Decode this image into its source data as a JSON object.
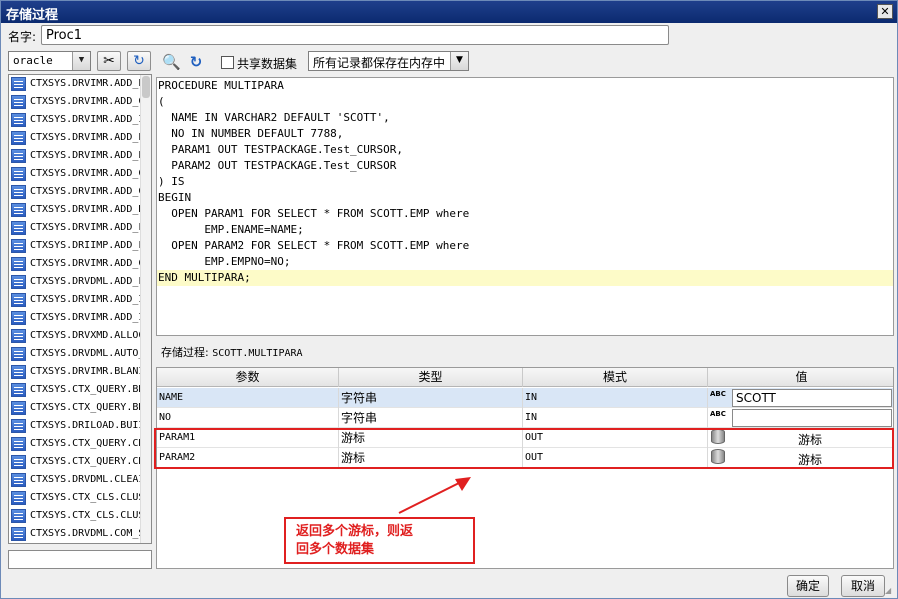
{
  "window": {
    "title": "存储过程",
    "close_glyph": "✕"
  },
  "name_field": {
    "label": "名字:",
    "value": "Proc1"
  },
  "toolbar": {
    "schema_combo": "oracle",
    "share_dataset_label": "共享数据集",
    "mode_combo": "所有记录都保存在内存中"
  },
  "object_list": [
    "CTXSYS.DRVIMR.ADD_E",
    "CTXSYS.DRVIMR.ADD_C",
    "CTXSYS.DRVIMR.ADD_I",
    "CTXSYS.DRVIMR.ADD_E",
    "CTXSYS.DRVIMR.ADD_E",
    "CTXSYS.DRVIMR.ADD_C",
    "CTXSYS.DRVIMR.ADD_C",
    "CTXSYS.DRVIMR.ADD_N",
    "CTXSYS.DRVIMR.ADD_F",
    "CTXSYS.DRIIMP.ADD_F",
    "CTXSYS.DRVIMR.ADD_C",
    "CTXSYS.DRVDML.ADD_F",
    "CTXSYS.DRVIMR.ADD_I",
    "CTXSYS.DRVIMR.ADD_I",
    "CTXSYS.DRVXMD.ALLOC",
    "CTXSYS.DRVDML.AUTO_",
    "CTXSYS.DRVIMR.BLANI",
    "CTXSYS.CTX_QUERY.BR",
    "CTXSYS.CTX_QUERY.BR",
    "CTXSYS.DRILOAD.BUII",
    "CTXSYS.CTX_QUERY.CR",
    "CTXSYS.CTX_QUERY.CR",
    "CTXSYS.DRVDML.CLEAI",
    "CTXSYS.CTX_CLS.CLUS",
    "CTXSYS.CTX_CLS.CLUS",
    "CTXSYS.DRVDML.COM_S"
  ],
  "editor": {
    "lines": [
      "PROCEDURE MULTIPARA",
      "(",
      "  NAME IN VARCHAR2 DEFAULT 'SCOTT',",
      "  NO IN NUMBER DEFAULT 7788,",
      "  PARAM1 OUT TESTPACKAGE.Test_CURSOR,",
      "  PARAM2 OUT TESTPACKAGE.Test_CURSOR",
      ") IS",
      "BEGIN",
      "  OPEN PARAM1 FOR SELECT * FROM SCOTT.EMP where",
      "       EMP.ENAME=NAME;",
      "  OPEN PARAM2 FOR SELECT * FROM SCOTT.EMP where",
      "       EMP.EMPNO=NO;",
      "END MULTIPARA;"
    ],
    "current_line_index": 12
  },
  "proc_info": {
    "label": "存储过程:",
    "value": "SCOTT.MULTIPARA"
  },
  "param_table": {
    "headers": [
      "参数",
      "类型",
      "模式",
      "值"
    ],
    "rows": [
      {
        "param": "NAME",
        "type": "字符串",
        "mode": "IN",
        "value": "SCOTT",
        "icon": "abc-icon"
      },
      {
        "param": "NO",
        "type": "字符串",
        "mode": "IN",
        "value": "",
        "icon": "abc-icon"
      },
      {
        "param": "PARAM1",
        "type": "游标",
        "mode": "OUT",
        "value": "游标",
        "icon": "database-icon"
      },
      {
        "param": "PARAM2",
        "type": "游标",
        "mode": "OUT",
        "value": "游标",
        "icon": "database-icon"
      }
    ],
    "abc_glyph": "ABC"
  },
  "annotation": {
    "text_line1": "返回多个游标，则返",
    "text_line2": "回多个数据集",
    "color": "#e02020"
  },
  "buttons": {
    "ok": "确定",
    "cancel": "取消"
  }
}
